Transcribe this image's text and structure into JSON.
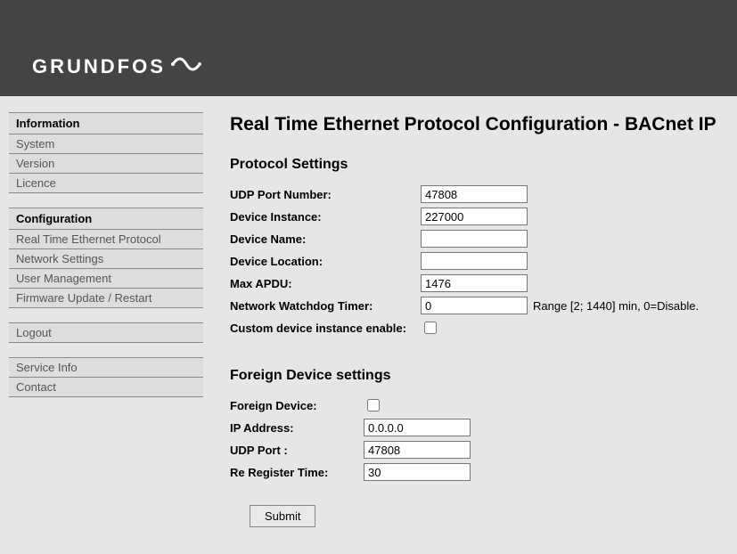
{
  "brand": "GRUNDFOS",
  "sidebar": {
    "groups": [
      {
        "title": "Information",
        "items": [
          "System",
          "Version",
          "Licence"
        ]
      },
      {
        "title": "Configuration",
        "items": [
          "Real Time Ethernet Protocol",
          "Network Settings",
          "User Management",
          "Firmware Update / Restart"
        ]
      },
      {
        "title": null,
        "items": [
          "Logout"
        ]
      },
      {
        "title": null,
        "items": [
          "Service Info",
          "Contact"
        ]
      }
    ]
  },
  "page": {
    "title": "Real Time Ethernet Protocol Configuration - BACnet IP",
    "section1": "Protocol Settings",
    "section2": "Foreign Device settings",
    "labels": {
      "udp_port_number": "UDP Port Number:",
      "device_instance": "Device Instance:",
      "device_name": "Device Name:",
      "device_location": "Device Location:",
      "max_apdu": "Max APDU:",
      "network_watchdog": "Network Watchdog Timer:",
      "custom_dev_inst": "Custom device instance enable:",
      "foreign_device": "Foreign Device:",
      "ip_address": "IP Address:",
      "udp_port": "UDP Port :",
      "re_register": "Re Register Time:"
    },
    "values": {
      "udp_port_number": "47808",
      "device_instance": "227000",
      "device_name": "",
      "device_location": "",
      "max_apdu": "1476",
      "network_watchdog": "0",
      "custom_dev_inst": false,
      "foreign_device": false,
      "ip_address": "0.0.0.0",
      "udp_port": "47808",
      "re_register": "30"
    },
    "hints": {
      "network_watchdog": "Range [2; 1440] min, 0=Disable."
    },
    "submit_label": "Submit"
  }
}
